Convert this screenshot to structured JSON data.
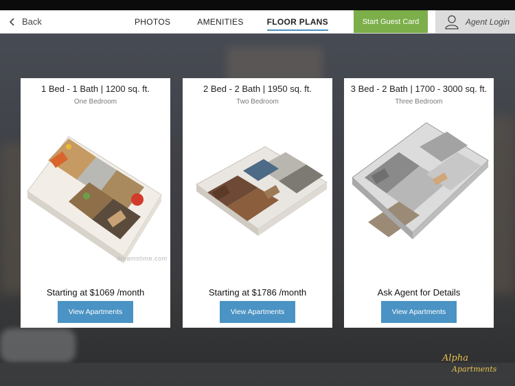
{
  "nav": {
    "back_label": "Back",
    "tabs": [
      "PHOTOS",
      "AMENITIES",
      "FLOOR PLANS"
    ],
    "active_tab": "FLOOR PLANS",
    "guest_card_label": "Start Guest Card",
    "agent_login_label": "Agent Login"
  },
  "cards": [
    {
      "title": "1 Bed - 1 Bath | 1200 sq. ft.",
      "subtitle": "One Bedroom",
      "price": "Starting at $1069 /month",
      "button": "View Apartments",
      "watermark": "dreamstime.com"
    },
    {
      "title": "2 Bed - 2 Bath | 1950 sq. ft.",
      "subtitle": "Two Bedroom",
      "price": "Starting at $1786 /month",
      "button": "View Apartments"
    },
    {
      "title": "3 Bed - 2 Bath | 1700 - 3000 sq. ft.",
      "subtitle": "Three Bedroom",
      "price": "Ask Agent for Details",
      "button": "View Apartments"
    }
  ],
  "logo": {
    "line1": "Alpha",
    "line2": "Apartments"
  },
  "colors": {
    "accent": "#4a93c4",
    "guest_button": "#7cae4a",
    "logo": "#e8c050"
  }
}
